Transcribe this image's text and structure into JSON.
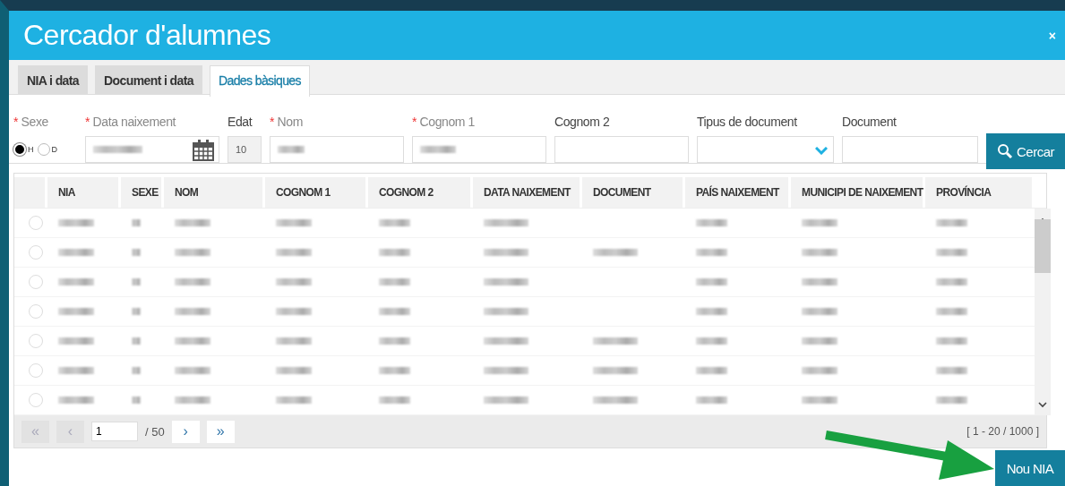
{
  "window": {
    "title": "Cercador d'alumnes",
    "close": "×"
  },
  "tabs": [
    {
      "label": "NIA i data",
      "selected": false
    },
    {
      "label": "Document i data",
      "selected": false
    },
    {
      "label": "Dades bàsiques",
      "selected": true
    }
  ],
  "form": {
    "fields": [
      {
        "kind": "radio",
        "label": "Sexe",
        "marker": "*",
        "options": [
          {
            "label": "H",
            "selected": true
          },
          {
            "label": "D",
            "selected": false
          }
        ]
      },
      {
        "kind": "date",
        "label": "Data naixement",
        "marker": "*",
        "redacted": true
      },
      {
        "kind": "readonly",
        "label": "Edat",
        "value": "10"
      },
      {
        "kind": "text",
        "label": "Nom",
        "marker": "*",
        "redacted": true
      },
      {
        "kind": "text",
        "label": "Cognom 1",
        "marker": "*",
        "redacted": true
      },
      {
        "kind": "text",
        "label": "Cognom 2",
        "redacted": false
      },
      {
        "kind": "select",
        "label": "Tipus de document"
      },
      {
        "kind": "text",
        "label": "Document",
        "redacted": false
      }
    ],
    "search_button": "Cercar"
  },
  "table": {
    "columns": [
      "NIA",
      "SEXE",
      "NOM",
      "COGNOM 1",
      "COGNOM 2",
      "DATA NAIXEMENT",
      "DOCUMENT",
      "PAÍS NAIXEMENT",
      "MUNICIPI DE NAIXEMENT",
      "PROVÍNCIA"
    ],
    "rows": [
      {
        "selected": false,
        "redacted_cells": [
          true,
          true,
          true,
          true,
          true,
          true,
          false,
          true,
          true,
          true
        ]
      },
      {
        "selected": false,
        "redacted_cells": [
          true,
          true,
          true,
          true,
          true,
          true,
          true,
          true,
          true,
          true
        ]
      },
      {
        "selected": false,
        "redacted_cells": [
          true,
          true,
          true,
          true,
          true,
          true,
          false,
          true,
          true,
          true
        ]
      },
      {
        "selected": false,
        "redacted_cells": [
          true,
          true,
          true,
          true,
          true,
          true,
          false,
          true,
          true,
          true
        ]
      },
      {
        "selected": false,
        "redacted_cells": [
          true,
          true,
          true,
          true,
          true,
          true,
          true,
          true,
          true,
          true
        ]
      },
      {
        "selected": false,
        "redacted_cells": [
          true,
          true,
          true,
          true,
          true,
          true,
          true,
          true,
          true,
          true
        ]
      },
      {
        "selected": false,
        "redacted_cells": [
          true,
          true,
          true,
          true,
          true,
          true,
          true,
          true,
          true,
          true
        ]
      }
    ]
  },
  "pager": {
    "first": "«",
    "prev": "‹",
    "page": "1",
    "total": "/ 50",
    "next": "›",
    "last": "»",
    "range": "[ 1 - 20 / 1000 ]"
  },
  "new_button": "Nou NIA"
}
